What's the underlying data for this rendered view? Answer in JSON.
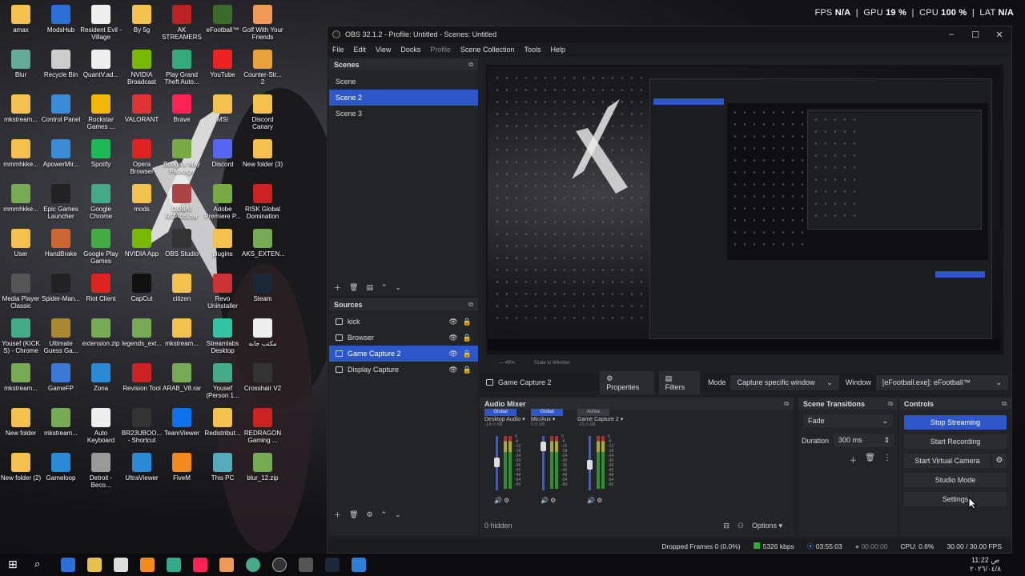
{
  "perf": {
    "fps_label": "FPS",
    "fps": "N/A",
    "gpu_label": "GPU",
    "gpu": "19 %",
    "cpu_label": "CPU",
    "cpu": "100 %",
    "lat_label": "LAT",
    "lat": "N/A"
  },
  "desktop": {
    "icons": [
      {
        "label": "amax",
        "color": "#f2c14e"
      },
      {
        "label": "ModsHub",
        "color": "#2c6fd6"
      },
      {
        "label": "Resident Evil - Village",
        "color": "#eee"
      },
      {
        "label": "By 5g",
        "color": "#f2c14e"
      },
      {
        "label": "AK STREAMERS",
        "color": "#b22"
      },
      {
        "label": "eFootball™",
        "color": "#3a6b2a"
      },
      {
        "label": "Golf With Your Friends",
        "color": "#e95"
      },
      {
        "label": "Blur",
        "color": "#6a9"
      },
      {
        "label": "Recycle Bin",
        "color": "#ccc"
      },
      {
        "label": "QuantV.ad...",
        "color": "#eee"
      },
      {
        "label": "NVIDIA Broadcast",
        "color": "#76b900"
      },
      {
        "label": "Play Grand Theft Auto...",
        "color": "#3a7"
      },
      {
        "label": "YouTube",
        "color": "#e22"
      },
      {
        "label": "Counter-Str... 2",
        "color": "#e9a13b"
      },
      {
        "label": "mkstream...",
        "color": "#f2c14e"
      },
      {
        "label": "Control Panel",
        "color": "#3a8ad6"
      },
      {
        "label": "Rockstar Games ...",
        "color": "#f2b705"
      },
      {
        "label": "VALORANT",
        "color": "#d33"
      },
      {
        "label": "Brave",
        "color": "#f25"
      },
      {
        "label": "MSI",
        "color": "#f2c14e"
      },
      {
        "label": "Discord Canary",
        "color": "#f2c14e"
      },
      {
        "label": "mmmhkke...",
        "color": "#f2c14e"
      },
      {
        "label": "ApowerMir...",
        "color": "#3a8ad6"
      },
      {
        "label": "Spotify",
        "color": "#1db954"
      },
      {
        "label": "Opera Browser",
        "color": "#d22"
      },
      {
        "label": "Booga's May Package",
        "color": "#7a4"
      },
      {
        "label": "Discord",
        "color": "#5865f2"
      },
      {
        "label": "New folder (3)",
        "color": "#f2c14e"
      },
      {
        "label": "mmmhkke...",
        "color": "#7a5"
      },
      {
        "label": "Epic Games Launcher",
        "color": "#222"
      },
      {
        "label": "Google Chrome",
        "color": "#4a8"
      },
      {
        "label": "mods",
        "color": "#f2c14e"
      },
      {
        "label": "DUBAI ROADS.rar",
        "color": "#a44"
      },
      {
        "label": "Adobe Premiere P...",
        "color": "#7a4"
      },
      {
        "label": "RISK Global Domination",
        "color": "#c22"
      },
      {
        "label": "User",
        "color": "#f2c14e"
      },
      {
        "label": "HandBrake",
        "color": "#c63"
      },
      {
        "label": "Google Play Games",
        "color": "#4a4"
      },
      {
        "label": "NVIDIA App",
        "color": "#76b900"
      },
      {
        "label": "OBS Studio",
        "color": "#333"
      },
      {
        "label": "plugins",
        "color": "#f2c14e"
      },
      {
        "label": "AKS_EXTEN...",
        "color": "#7a5"
      },
      {
        "label": "Media Player Classic",
        "color": "#555"
      },
      {
        "label": "Spider-Man...",
        "color": "#222"
      },
      {
        "label": "Riot Client",
        "color": "#d22"
      },
      {
        "label": "CapCut",
        "color": "#111"
      },
      {
        "label": "citizen",
        "color": "#f2c14e"
      },
      {
        "label": "Revo Uninstaller",
        "color": "#c33"
      },
      {
        "label": "Steam",
        "color": "#1b2838"
      },
      {
        "label": "Yousef (KICK S) - Chrome",
        "color": "#4a8"
      },
      {
        "label": "Ultimate Guess Ga...",
        "color": "#a83"
      },
      {
        "label": "extension.zip",
        "color": "#7a5"
      },
      {
        "label": "legends_ext...",
        "color": "#7a5"
      },
      {
        "label": "mkstream...",
        "color": "#f2c14e"
      },
      {
        "label": "Streamlabs Desktop",
        "color": "#31c3a2"
      },
      {
        "label": "مكتب جابه",
        "color": "#eee"
      },
      {
        "label": "mkstream...",
        "color": "#7a5"
      },
      {
        "label": "GameFP",
        "color": "#3a7ad6"
      },
      {
        "label": "Zona",
        "color": "#2a8ad6"
      },
      {
        "label": "Revision Tool",
        "color": "#c22"
      },
      {
        "label": "ARAB_V8.rar",
        "color": "#7a5"
      },
      {
        "label": "Yousef (Person 1...",
        "color": "#4a8"
      },
      {
        "label": "Crosshair V2",
        "color": "#333"
      },
      {
        "label": "New folder",
        "color": "#f2c14e"
      },
      {
        "label": "mkstream...",
        "color": "#7a5"
      },
      {
        "label": "Auto Keyboard",
        "color": "#eee"
      },
      {
        "label": "BR23UBOO... - Shortcut",
        "color": "#333"
      },
      {
        "label": "TeamViewer",
        "color": "#0e72ed"
      },
      {
        "label": "Redistribut...",
        "color": "#f2c14e"
      },
      {
        "label": "REDRAGON Gaming ...",
        "color": "#c22"
      },
      {
        "label": "New folder (2)",
        "color": "#f2c14e"
      },
      {
        "label": "Gameloop",
        "color": "#2a8ad6"
      },
      {
        "label": "Detroit - Beco...",
        "color": "#999"
      },
      {
        "label": "UltraViewer",
        "color": "#2a8ad6"
      },
      {
        "label": "FiveM",
        "color": "#f28a1e"
      },
      {
        "label": "This PC",
        "color": "#5ab"
      },
      {
        "label": "blur_12.zip",
        "color": "#7a5"
      }
    ]
  },
  "obs": {
    "title": "OBS 32.1.2 - Profile: Untitled - Scenes: Untitled",
    "menu": [
      "File",
      "Edit",
      "View",
      "Docks",
      "Profile",
      "Scene Collection",
      "Tools",
      "Help"
    ],
    "scenes": {
      "title": "Scenes",
      "items": [
        "Scene",
        "Scene 2",
        "Scene 3"
      ],
      "selected": 1
    },
    "sources": {
      "title": "Sources",
      "items": [
        "kick",
        "Browser",
        "Game Capture 2",
        "Display Capture"
      ],
      "selected": 2
    },
    "preview": {
      "zoom": "— 49%",
      "scale_label": "Scale to Window"
    },
    "propbar": {
      "source_name": "Game Capture 2",
      "properties": "Properties",
      "filters": "Filters",
      "mode_label": "Mode",
      "mode_value": "Capture specific window",
      "window_label": "Window",
      "window_value": "[eFootball.exe]: eFootball™"
    },
    "mixer": {
      "title": "Audio Mixer",
      "channels": [
        {
          "tag": "Global",
          "name": "Desktop Audio",
          "db": "-14.0 dB",
          "active": true
        },
        {
          "tag": "Global",
          "name": "Mic/Aux",
          "db": "0.0 dB",
          "active": true
        },
        {
          "tag": "Active",
          "name": "Game Capture 2",
          "db": "-15.3 dB",
          "active": false
        }
      ],
      "scale": [
        "0",
        "-6",
        "-12",
        "-18",
        "-24",
        "-30",
        "-36",
        "-42",
        "-48",
        "-54",
        "-60"
      ],
      "hidden": "0 hidden",
      "options": "Options"
    },
    "transitions": {
      "title": "Scene Transitions",
      "type": "Fade",
      "duration_label": "Duration",
      "duration": "300 ms"
    },
    "controls": {
      "title": "Controls",
      "stop_streaming": "Stop Streaming",
      "start_recording": "Start Recording",
      "start_virtual_camera": "Start Virtual Camera",
      "studio_mode": "Studio Mode",
      "settings": "Settings"
    },
    "status": {
      "dropped": "Dropped Frames 0 (0.0%)",
      "bitrate": "5326 kbps",
      "stream_time": "03:55:03",
      "rec_time": "00:00:00",
      "cpu": "CPU: 0.6%",
      "fps": "30.00 / 30.00 FPS"
    }
  },
  "taskbar": {
    "time": "11:22 ص",
    "date": "٢٠٢٦/٠٤/٨"
  },
  "colors": {
    "accent": "#2d56c8",
    "panel": "#232428",
    "window": "#1e1f22"
  }
}
